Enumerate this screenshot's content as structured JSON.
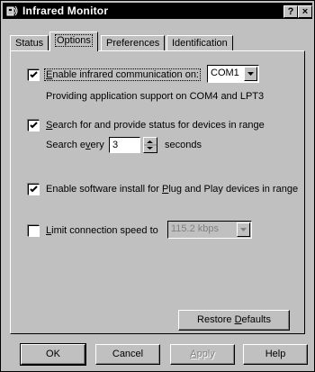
{
  "window": {
    "title": "Infrared Monitor",
    "help_glyph": "?",
    "close_glyph": "×"
  },
  "tabs": [
    {
      "label": "Status",
      "active": false
    },
    {
      "label": "Options",
      "active": true
    },
    {
      "label": "Preferences",
      "active": false
    },
    {
      "label": "Identification",
      "active": false
    }
  ],
  "options": {
    "enable_ir": {
      "checked": true,
      "label_pre": "",
      "label_accel": "E",
      "label_post": "nable infrared communication on:",
      "port_value": "COM1"
    },
    "support_text": "Providing application support on COM4 and LPT3",
    "search": {
      "checked": true,
      "label_accel": "S",
      "label_post": "earch for and provide status for devices in range",
      "every_pre": "Search e",
      "every_accel": "v",
      "every_post": "ery",
      "interval_value": "3",
      "unit_label": "seconds"
    },
    "pnp": {
      "checked": true,
      "label_pre": "Enable software install for ",
      "label_accel": "P",
      "label_post": "lug and Play devices in range"
    },
    "limit_speed": {
      "checked": false,
      "label_accel": "L",
      "label_post": "imit connection speed to",
      "speed_value": "115.2 kbps"
    },
    "restore_button": {
      "pre": "Restore ",
      "accel": "D",
      "post": "efaults"
    }
  },
  "footer": {
    "ok_label": "OK",
    "cancel_label": "Cancel",
    "apply_pre": "",
    "apply_accel": "A",
    "apply_post": "pply",
    "help_label": "Help"
  }
}
